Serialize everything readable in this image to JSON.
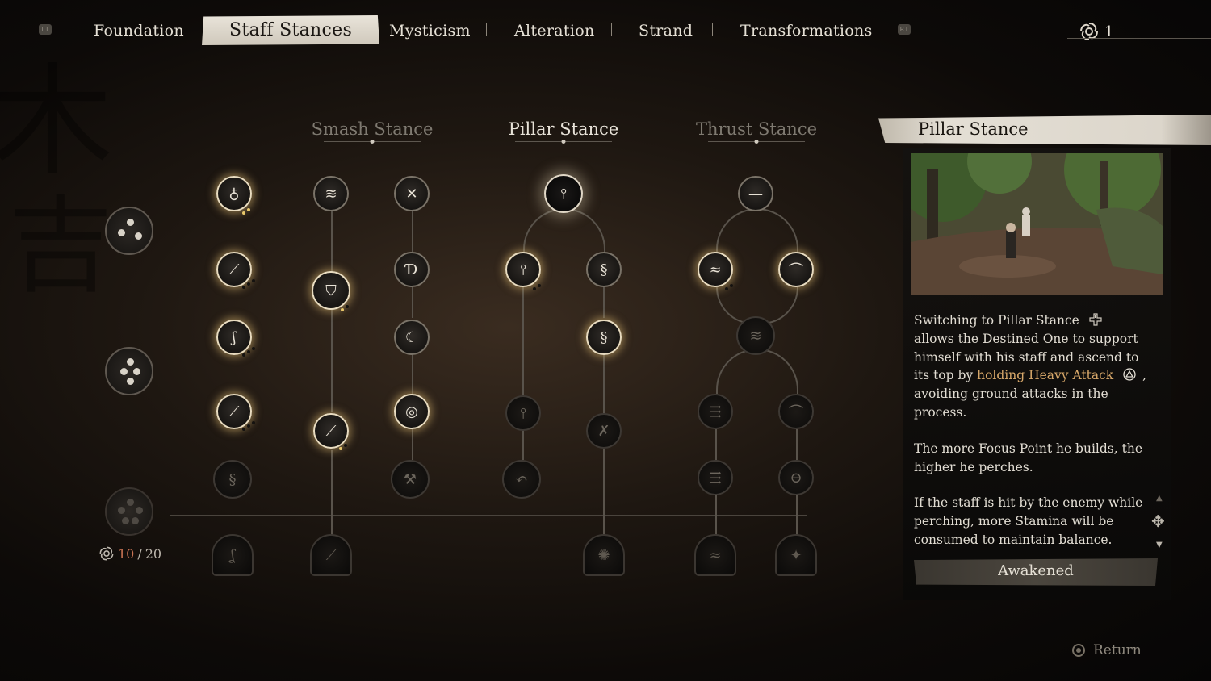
{
  "tabs": {
    "left_shoulder": "L1",
    "right_shoulder": "R1",
    "items": [
      {
        "label": "Foundation"
      },
      {
        "label": "Staff Stances",
        "active": true
      },
      {
        "label": "Mysticism"
      },
      {
        "label": "Alteration"
      },
      {
        "label": "Strand"
      },
      {
        "label": "Transformations"
      }
    ]
  },
  "currency": {
    "icon": "spark-swirl-icon",
    "value": "1"
  },
  "stances": {
    "smash": "Smash Stance",
    "pillar": "Pillar Stance",
    "thrust": "Thrust Stance",
    "selected": "pillar"
  },
  "focus_points": {
    "current": "10",
    "separator": "/",
    "max": "20"
  },
  "panel": {
    "title": "Pillar Stance",
    "desc_1a": "Switching to Pillar Stance",
    "desc_1b": "allows the Destined One to support himself with his staff and ascend to its top by",
    "desc_1_highlight": "holding Heavy Attack",
    "desc_1c": ", avoiding ground attacks in the process.",
    "desc_2": "The more Focus Point he builds, the higher he perches.",
    "desc_3": "If the staff is hit by the enemy while perching, more Stamina will be consumed to maintain balance.",
    "status": "Awakened",
    "highlight_color": "#d8a86a"
  },
  "footer": {
    "return_label": "Return",
    "return_icon": "circle-button-icon"
  },
  "colors": {
    "accent_gold": "#e7c66a",
    "points_current": "#c97454"
  }
}
